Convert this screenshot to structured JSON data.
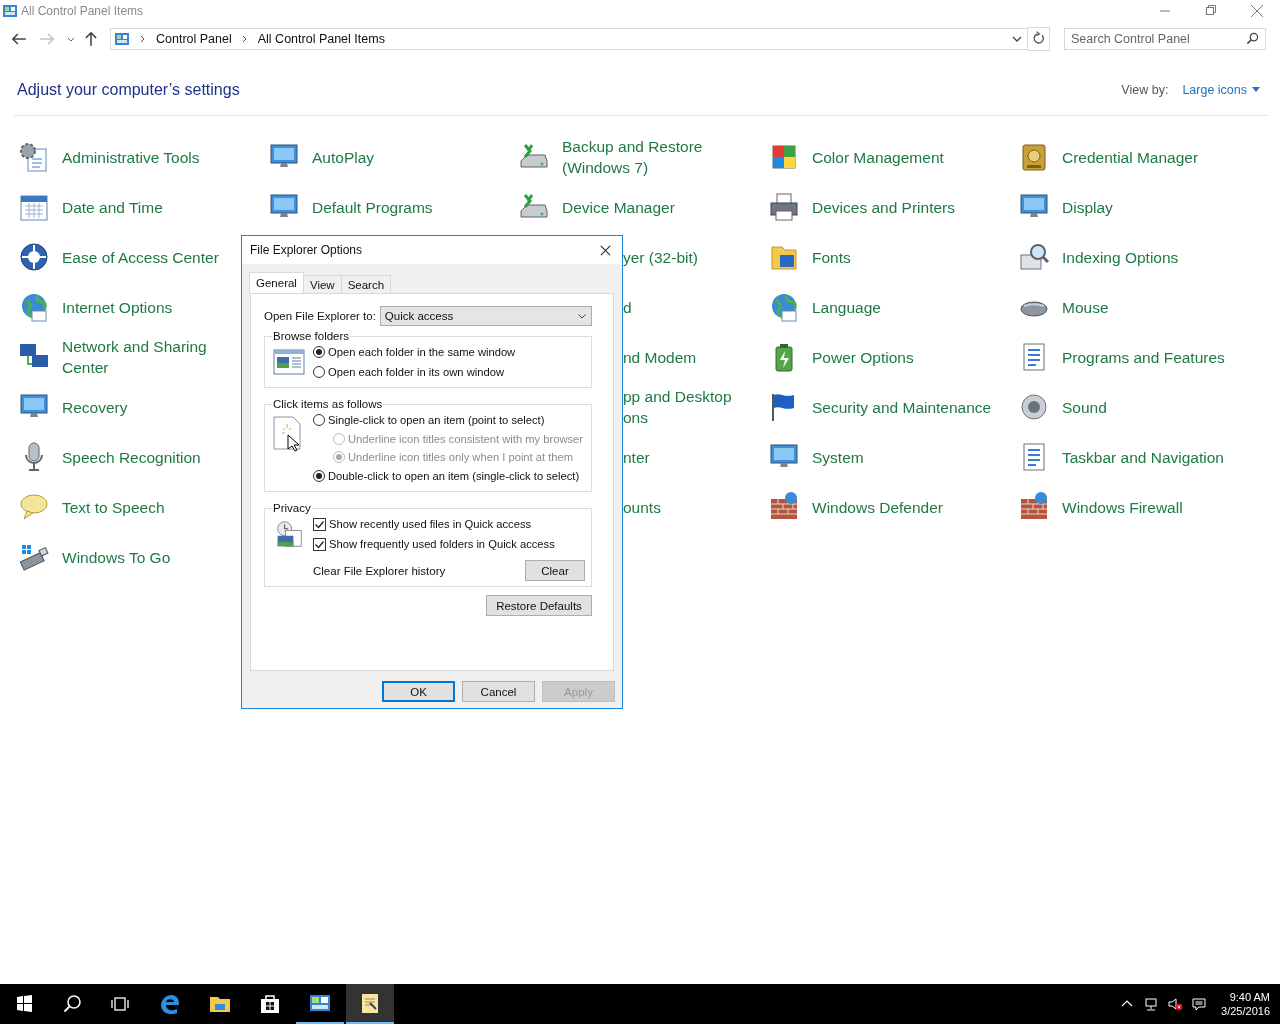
{
  "window": {
    "title": "All Control Panel Items"
  },
  "address_bar": {
    "breadcrumbs": [
      "Control Panel",
      "All Control Panel Items"
    ]
  },
  "search": {
    "placeholder": "Search Control Panel"
  },
  "heading": "Adjust your computer’s settings",
  "view_by": {
    "label": "View by:",
    "value": "Large icons"
  },
  "columns": [
    {
      "items": [
        {
          "kind": "item",
          "label": "Administrative Tools"
        },
        {
          "kind": "item",
          "label": "Date and Time"
        },
        {
          "kind": "item",
          "label": "Ease of Access Center"
        },
        {
          "kind": "item",
          "label": "Internet Options"
        },
        {
          "kind": "item",
          "label": "Network and Sharing Center"
        },
        {
          "kind": "item",
          "label": "Recovery"
        },
        {
          "kind": "item",
          "label": "Speech Recognition"
        },
        {
          "kind": "item",
          "label": "Text to Speech"
        },
        {
          "kind": "item",
          "label": "Windows To Go"
        }
      ]
    },
    {
      "items": [
        {
          "kind": "item",
          "label": "AutoPlay"
        },
        {
          "kind": "item",
          "label": "Default Programs"
        }
      ]
    },
    {
      "items": [
        {
          "kind": "item",
          "label": "Backup and Restore (Windows 7)"
        },
        {
          "kind": "item",
          "label": "Device Manager"
        },
        {
          "kind": "cut",
          "label": "yer (32-bit)"
        },
        {
          "kind": "cut",
          "label": "d"
        },
        {
          "kind": "cut",
          "label": "nd Modem"
        },
        {
          "kind": "cut",
          "label": "pp and Desktop\nons"
        },
        {
          "kind": "cut",
          "label": "nter"
        },
        {
          "kind": "cut",
          "label": "ounts"
        }
      ]
    },
    {
      "items": [
        {
          "kind": "item",
          "label": "Color Management"
        },
        {
          "kind": "item",
          "label": "Devices and Printers"
        },
        {
          "kind": "item",
          "label": "Fonts"
        },
        {
          "kind": "item",
          "label": "Language"
        },
        {
          "kind": "item",
          "label": "Power Options"
        },
        {
          "kind": "item",
          "label": "Security and Maintenance"
        },
        {
          "kind": "item",
          "label": "System"
        },
        {
          "kind": "item",
          "label": "Windows Defender"
        }
      ]
    },
    {
      "items": [
        {
          "kind": "item",
          "label": "Credential Manager"
        },
        {
          "kind": "item",
          "label": "Display"
        },
        {
          "kind": "item",
          "label": "Indexing Options"
        },
        {
          "kind": "item",
          "label": "Mouse"
        },
        {
          "kind": "item",
          "label": "Programs and Features"
        },
        {
          "kind": "item",
          "label": "Sound"
        },
        {
          "kind": "item",
          "label": "Taskbar and Navigation"
        },
        {
          "kind": "item",
          "label": "Windows Firewall"
        }
      ]
    }
  ],
  "dialog": {
    "title": "File Explorer Options",
    "tabs": [
      {
        "label": "General",
        "selected": true
      },
      {
        "label": "View",
        "selected": false
      },
      {
        "label": "Search",
        "selected": false
      }
    ],
    "open_to": {
      "label": "Open File Explorer to:",
      "value": "Quick access"
    },
    "groups": [
      {
        "kind": "browse",
        "title": "Browse folders",
        "options": [
          {
            "kind": "radio",
            "label": "Open each folder in the same window",
            "checked": true,
            "disabled": false
          },
          {
            "kind": "radio",
            "label": "Open each folder in its own window",
            "checked": false,
            "disabled": false
          }
        ]
      },
      {
        "kind": "click",
        "title": "Click items as follows",
        "options": [
          {
            "kind": "radio",
            "label": "Single-click to open an item (point to select)",
            "checked": false,
            "disabled": false,
            "children": [
              {
                "kind": "radio",
                "label": "Underline icon titles consistent with my browser",
                "checked": false,
                "disabled": true
              },
              {
                "kind": "radio",
                "label": "Underline icon titles only when I point at them",
                "checked": true,
                "disabled": true
              }
            ]
          },
          {
            "kind": "radio",
            "label": "Double-click to open an item (single-click to select)",
            "checked": true,
            "disabled": false
          }
        ]
      },
      {
        "kind": "privacy",
        "title": "Privacy",
        "options": [
          {
            "kind": "checkbox",
            "label": "Show recently used files in Quick access",
            "checked": true,
            "disabled": false
          },
          {
            "kind": "checkbox",
            "label": "Show frequently used folders in Quick access",
            "checked": true,
            "disabled": false
          }
        ],
        "history": {
          "label": "Clear File Explorer history",
          "button": "Clear"
        }
      }
    ],
    "restore_button": "Restore Defaults",
    "buttons": [
      {
        "label": "OK",
        "default": true,
        "disabled": false
      },
      {
        "label": "Cancel",
        "default": false,
        "disabled": false
      },
      {
        "label": "Apply",
        "default": false,
        "disabled": true
      }
    ]
  },
  "taskbar": {
    "apps": [
      {
        "kind": "edge",
        "open": false,
        "selected": false
      },
      {
        "kind": "explorer",
        "open": false,
        "selected": false
      },
      {
        "kind": "store",
        "open": false,
        "selected": false
      },
      {
        "kind": "control-panel",
        "open": true,
        "selected": false
      },
      {
        "kind": "notepad",
        "open": true,
        "selected": true
      }
    ]
  },
  "clock": {
    "time": "9:40 AM",
    "date": "3/25/2016"
  }
}
